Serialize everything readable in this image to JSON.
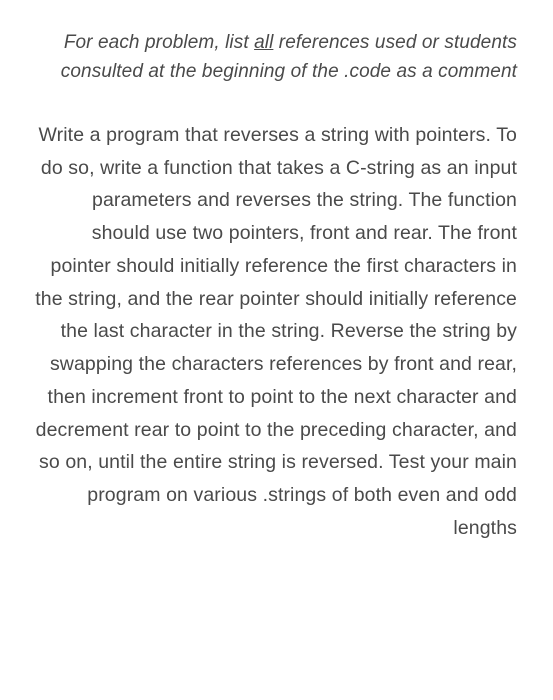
{
  "instruction": {
    "prefix": "For each problem, list ",
    "underlined": "all",
    "suffix": " references used or students consulted at the beginning of the .code as a comment"
  },
  "problem": {
    "text": "Write a program that reverses a string with pointers. To do so, write a function that takes a C-string as an input parameters and reverses the string. The function should use two pointers, front and rear. The front pointer should initially reference the first characters in the string, and the rear pointer should initially reference the last character in the string. Reverse the string by swapping the characters references by front and rear, then increment front to point to the next character and decrement rear to point to the preceding character, and so on, until the entire string is reversed. Test your main program on various .strings of both even and odd lengths"
  }
}
